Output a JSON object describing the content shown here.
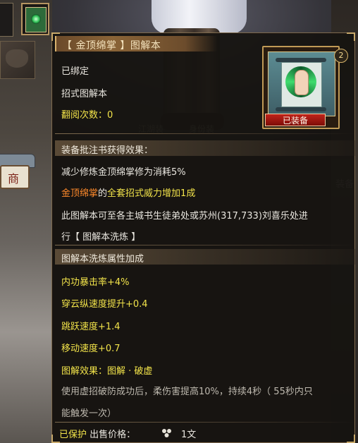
{
  "item": {
    "title": "【 金顶绵掌 】图解本",
    "bind_status": "已绑定",
    "category": "招式图解本",
    "read_count": "翻阅次数：0",
    "equipped_badge": "已装备",
    "grade_badge": "2"
  },
  "background": {
    "shop_label": "商",
    "right_label": "装备",
    "tabs": [
      "江湖装",
      "身份装"
    ]
  },
  "annotation_section": {
    "header": "装备批注书获得效果：",
    "line1": "减少修炼金顶绵掌修为消耗5%",
    "line2_skill": "金顶绵掌",
    "line2_de": "的",
    "line2_set": "全套招式",
    "line2_rest": "威力增加1成",
    "line3": "此图解本可至各主城书生徒弟处或苏州(317,733)刘喜乐处进",
    "line4": "行【 图解本洗炼 】"
  },
  "refine_section": {
    "header": "图解本洗炼属性加成",
    "attrs": [
      "内功暴击率+4%",
      "穿云纵速度提升+0.4",
      "跳跃速度+1.4",
      "移动速度+0.7"
    ],
    "effect_title": "图解效果：图解 · 破虚",
    "effect_desc1": "使用虚招破防成功后，柔伤害提高10%，持续4秒（ 55秒内只",
    "effect_desc2": "能触发一次）"
  },
  "footer": {
    "protected": "已保护",
    "price_label": "出售价格：",
    "price_value": "1文"
  },
  "colors": {
    "yellow": "#f2e34a",
    "orange": "#ff8a2b",
    "white": "#e9e6df",
    "gray": "#bdb8ae",
    "equipped_red": "#c0231a"
  }
}
